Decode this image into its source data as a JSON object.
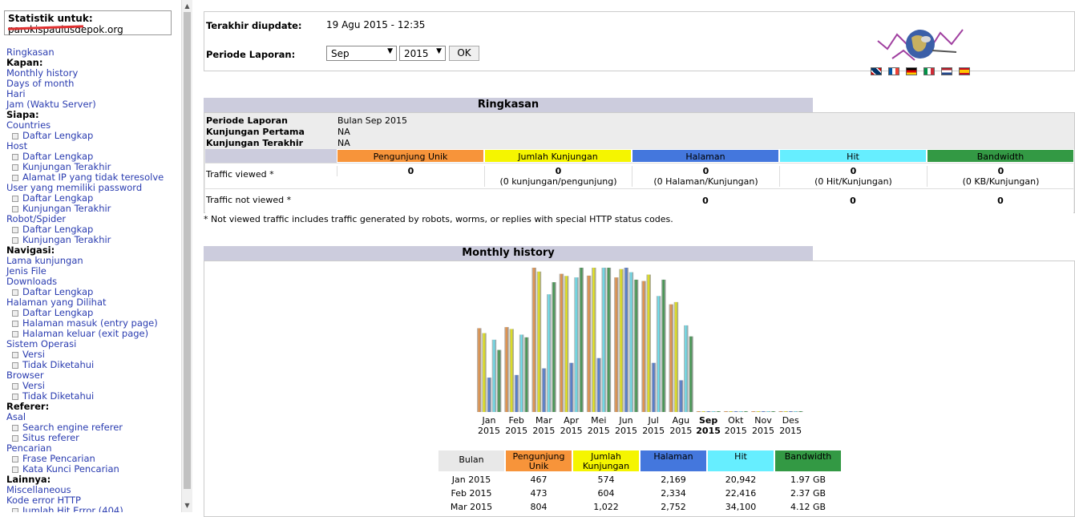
{
  "sidebar": {
    "stat_label": "Statistik untuk:",
    "stat_site": "parokispaulusdepok.org",
    "menu": [
      {
        "t": "l",
        "text": "Ringkasan"
      },
      {
        "t": "h",
        "text": "Kapan:"
      },
      {
        "t": "l",
        "text": "Monthly history"
      },
      {
        "t": "l",
        "text": "Days of month"
      },
      {
        "t": "l",
        "text": "Hari"
      },
      {
        "t": "l",
        "text": "Jam (Waktu Server)"
      },
      {
        "t": "h",
        "text": "Siapa:"
      },
      {
        "t": "l",
        "text": "Countries"
      },
      {
        "t": "s",
        "text": "Daftar Lengkap"
      },
      {
        "t": "l",
        "text": "Host"
      },
      {
        "t": "s",
        "text": "Daftar Lengkap"
      },
      {
        "t": "s",
        "text": "Kunjungan Terakhir"
      },
      {
        "t": "s",
        "text": "Alamat IP yang tidak teresolve"
      },
      {
        "t": "l",
        "text": "User yang memiliki password"
      },
      {
        "t": "s",
        "text": "Daftar Lengkap"
      },
      {
        "t": "s",
        "text": "Kunjungan Terakhir"
      },
      {
        "t": "l",
        "text": "Robot/Spider"
      },
      {
        "t": "s",
        "text": "Daftar Lengkap"
      },
      {
        "t": "s",
        "text": "Kunjungan Terakhir"
      },
      {
        "t": "h",
        "text": "Navigasi:"
      },
      {
        "t": "l",
        "text": "Lama kunjungan"
      },
      {
        "t": "l",
        "text": "Jenis File"
      },
      {
        "t": "l",
        "text": "Downloads"
      },
      {
        "t": "s",
        "text": "Daftar Lengkap"
      },
      {
        "t": "l",
        "text": "Halaman yang Dilihat"
      },
      {
        "t": "s",
        "text": "Daftar Lengkap"
      },
      {
        "t": "s",
        "text": "Halaman masuk (entry page)"
      },
      {
        "t": "s",
        "text": "Halaman keluar (exit page)"
      },
      {
        "t": "l",
        "text": "Sistem Operasi"
      },
      {
        "t": "s",
        "text": "Versi"
      },
      {
        "t": "s",
        "text": "Tidak Diketahui"
      },
      {
        "t": "l",
        "text": "Browser"
      },
      {
        "t": "s",
        "text": "Versi"
      },
      {
        "t": "s",
        "text": "Tidak Diketahui"
      },
      {
        "t": "h",
        "text": "Referer:"
      },
      {
        "t": "l",
        "text": "Asal"
      },
      {
        "t": "s",
        "text": "Search engine referer"
      },
      {
        "t": "s",
        "text": "Situs referer"
      },
      {
        "t": "l",
        "text": "Pencarian"
      },
      {
        "t": "s",
        "text": "Frase Pencarian"
      },
      {
        "t": "s",
        "text": "Kata Kunci Pencarian"
      },
      {
        "t": "h",
        "text": "Lainnya:"
      },
      {
        "t": "l",
        "text": "Miscellaneous"
      },
      {
        "t": "l",
        "text": "Kode error HTTP"
      },
      {
        "t": "s",
        "text": "Jumlah Hit Error (404)"
      }
    ]
  },
  "top": {
    "updated_label": "Terakhir diupdate:",
    "updated_value": "19 Agu 2015 - 12:35",
    "period_label": "Periode Laporan:",
    "month_value": "Sep",
    "year_value": "2015",
    "ok_label": "OK"
  },
  "colors": {
    "unique": "#f7943a",
    "visits": "#f5f500",
    "pages": "#4477dd",
    "hits": "#66eeff",
    "bandwidth": "#339944"
  },
  "summary": {
    "title": "Ringkasan",
    "rows": [
      {
        "label": "Periode Laporan",
        "value": "Bulan Sep 2015"
      },
      {
        "label": "Kunjungan Pertama",
        "value": "NA"
      },
      {
        "label": "Kunjungan Terakhir",
        "value": "NA"
      }
    ],
    "headers": [
      "Pengunjung Unik",
      "Jumlah Kunjungan",
      "Halaman",
      "Hit",
      "Bandwidth"
    ],
    "viewed_label": "Traffic viewed *",
    "viewed": [
      "0",
      "0",
      "0",
      "0",
      "0"
    ],
    "viewed_sub": [
      "",
      "(0 kunjungan/pengunjung)",
      "(0 Halaman/Kunjungan)",
      "(0 Hit/Kunjungan)",
      "(0 KB/Kunjungan)"
    ],
    "notviewed_label": "Traffic not viewed *",
    "notviewed": [
      "",
      "",
      "0",
      "0",
      "0"
    ],
    "note": "* Not viewed traffic includes traffic generated by robots, worms, or replies with special HTTP status codes."
  },
  "monthly": {
    "title": "Monthly history",
    "table_headers": [
      "Bulan",
      "Pengunjung Unik",
      "Jumlah Kunjungan",
      "Halaman",
      "Hit",
      "Bandwidth"
    ],
    "rows": [
      [
        "Jan 2015",
        "467",
        "574",
        "2,169",
        "20,942",
        "1.97 GB"
      ],
      [
        "Feb 2015",
        "473",
        "604",
        "2,334",
        "22,416",
        "2.37 GB"
      ],
      [
        "Mar 2015",
        "804",
        "1,022",
        "2,752",
        "34,100",
        "4.12 GB"
      ]
    ]
  },
  "chart_data": {
    "type": "bar",
    "categories": [
      "Jan",
      "Feb",
      "Mar",
      "Apr",
      "Mei",
      "Jun",
      "Jul",
      "Agu",
      "Sep",
      "Okt",
      "Nov",
      "Des"
    ],
    "years": [
      "2015",
      "2015",
      "2015",
      "2015",
      "2015",
      "2015",
      "2015",
      "2015",
      "2015",
      "2015",
      "2015",
      "2015"
    ],
    "highlight": "Sep",
    "series": [
      {
        "name": "Pengunjung Unik",
        "color": "#f7943a",
        "values": [
          467,
          473,
          804,
          770,
          760,
          750,
          730,
          600,
          0,
          0,
          0,
          0
        ]
      },
      {
        "name": "Jumlah Kunjungan",
        "color": "#f5f500",
        "values": [
          574,
          604,
          1022,
          990,
          1050,
          1040,
          1000,
          800,
          0,
          0,
          0,
          0
        ]
      },
      {
        "name": "Halaman",
        "color": "#4477dd",
        "values": [
          2169,
          2334,
          2752,
          3100,
          3400,
          9100,
          3100,
          2000,
          0,
          0,
          0,
          0
        ]
      },
      {
        "name": "Hit",
        "color": "#66eeff",
        "values": [
          20942,
          22416,
          34100,
          39000,
          41800,
          40500,
          33600,
          25100,
          0,
          0,
          0,
          0
        ]
      },
      {
        "name": "Bandwidth",
        "color": "#339944",
        "values": [
          1.97,
          2.37,
          4.12,
          4.58,
          4.58,
          4.2,
          4.2,
          2.4,
          0,
          0,
          0,
          0
        ]
      }
    ]
  }
}
